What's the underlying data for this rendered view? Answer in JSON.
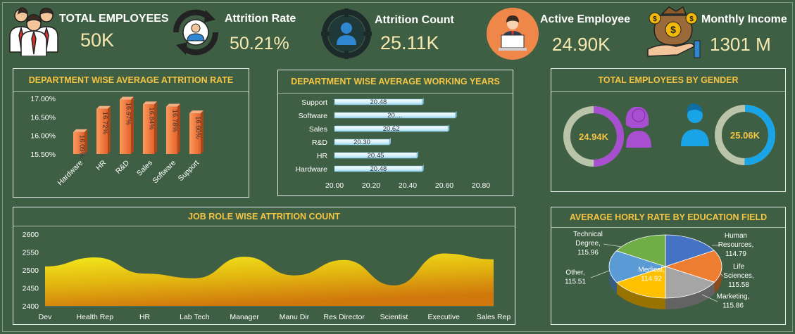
{
  "kpis": [
    {
      "label": "TOTAL EMPLOYEES",
      "value": "50K",
      "icon": "employees-group-icon"
    },
    {
      "label": "Attrition Rate",
      "value": "50.21%",
      "icon": "person-cycle-icon"
    },
    {
      "label": "Attrition Count",
      "value": "25.11K",
      "icon": "person-target-icon"
    },
    {
      "label": "Active Employee",
      "value": "24.90K",
      "icon": "person-laptop-icon"
    },
    {
      "label": "Monthly Income",
      "value": "1301 M",
      "icon": "money-hand-icon"
    }
  ],
  "colors": {
    "background": "#3f5f44",
    "title": "#f5c542",
    "kpi_value": "#f6e9b0",
    "bar": "#f07a3a",
    "female": "#a84ed0",
    "male": "#1aa4e8",
    "area_top": "#f4ef1c",
    "area_bottom": "#d0780c"
  },
  "chart_data": [
    {
      "type": "bar",
      "title": "DEPARTMENT WISE AVERAGE ATTRITION RATE",
      "categories": [
        "Hardware",
        "HR",
        "R&D",
        "Sales",
        "Software",
        "Support"
      ],
      "values": [
        16.09,
        16.72,
        16.97,
        16.84,
        16.78,
        16.6
      ],
      "data_labels": [
        "16.09%",
        "16.72%",
        "16.97%",
        "16.84%",
        "16.78%",
        "16.60%"
      ],
      "yticks": [
        "17.00%",
        "16.50%",
        "16.00%",
        "15.50%"
      ],
      "ylim": [
        15.5,
        17.0
      ]
    },
    {
      "type": "bar",
      "orientation": "horizontal",
      "title": "DEPARTMENT WISE AVERAGE WORKING YEARS",
      "categories": [
        "Support",
        "Software",
        "Sales",
        "R&D",
        "HR",
        "Hardware"
      ],
      "values": [
        20.48,
        20.66,
        20.62,
        20.3,
        20.45,
        20.48
      ],
      "data_labels": [
        "20.48",
        "20....",
        "20.62",
        "20.30",
        "20.45",
        "20.48"
      ],
      "xticks": [
        "20.00",
        "20.20",
        "20.40",
        "20.60",
        "20.80"
      ],
      "xlim": [
        20.0,
        20.8
      ]
    },
    {
      "type": "pie",
      "title": "TOTAL EMPLOYEES BY GENDER",
      "slices": [
        {
          "label": "24.94K",
          "fraction": 0.4982,
          "color": "#a84ed0"
        },
        {
          "label": "25.06K",
          "fraction": 0.5018,
          "color": "#1aa4e8"
        }
      ]
    },
    {
      "type": "area",
      "title": "JOB ROLE WISE ATTRITION COUNT",
      "categories": [
        "Dev",
        "Health Rep",
        "HR",
        "Lab Tech",
        "Manager",
        "Manu Dir",
        "Res Director",
        "Scientist",
        "Executive",
        "Sales Rep"
      ],
      "values": [
        2510,
        2535,
        2490,
        2477,
        2537,
        2485,
        2528,
        2457,
        2546,
        2530
      ],
      "yticks": [
        "2600",
        "2550",
        "2500",
        "2450",
        "2400"
      ],
      "ylim": [
        2400,
        2600
      ]
    },
    {
      "type": "pie",
      "title": "AVERAGE HORLY RATE BY EDUCATION FIELD",
      "slices": [
        {
          "name": "Human Resources",
          "value": 114.79,
          "label": "Human\nResources,\n114.79",
          "color": "#4472c4"
        },
        {
          "name": "Life Sciences",
          "value": 115.58,
          "label": "Life\nSciences,\n115.58",
          "color": "#ed7d31"
        },
        {
          "name": "Marketing",
          "value": 115.86,
          "label": "Marketing,\n115.86",
          "color": "#a5a5a5"
        },
        {
          "name": "Medical",
          "value": 114.92,
          "label": "Medical,\n114.92",
          "color": "#ffc000"
        },
        {
          "name": "Other",
          "value": 115.51,
          "label": "Other,\n115.51",
          "color": "#5b9bd5"
        },
        {
          "name": "Technical Degree",
          "value": 115.96,
          "label": "Technical\nDegree,\n115.96",
          "color": "#70ad47"
        }
      ]
    }
  ]
}
